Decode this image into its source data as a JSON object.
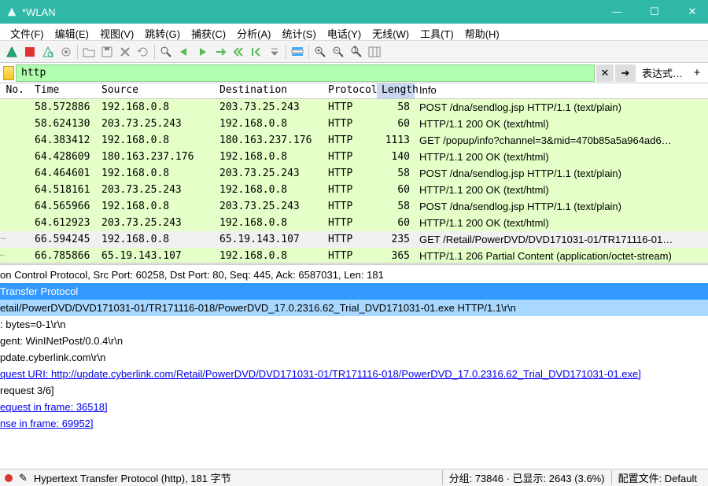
{
  "title": "*WLAN",
  "menu": [
    "文件(F)",
    "编辑(E)",
    "视图(V)",
    "跳转(G)",
    "捕获(C)",
    "分析(A)",
    "统计(S)",
    "电话(Y)",
    "无线(W)",
    "工具(T)",
    "帮助(H)"
  ],
  "filter": {
    "value": "http",
    "expr_label": "表达式…",
    "clear": "✕",
    "go": "➔",
    "plus": "+"
  },
  "columns": [
    "No.",
    "Time",
    "Source",
    "Destination",
    "Protocol",
    "Length",
    "Info"
  ],
  "rows": [
    {
      "no": "",
      "time": "58.572886",
      "src": "192.168.0.8",
      "dst": "203.73.25.243",
      "proto": "HTTP",
      "len": "58",
      "info": "POST /dna/sendlog.jsp HTTP/1.1  (text/plain)",
      "cls": "http"
    },
    {
      "no": "",
      "time": "58.624130",
      "src": "203.73.25.243",
      "dst": "192.168.0.8",
      "proto": "HTTP",
      "len": "60",
      "info": "HTTP/1.1 200 OK  (text/html)",
      "cls": "http"
    },
    {
      "no": "",
      "time": "64.383412",
      "src": "192.168.0.8",
      "dst": "180.163.237.176",
      "proto": "HTTP",
      "len": "1113",
      "info": "GET /popup/info?channel=3&mid=470b85a5a964ad6…",
      "cls": "http"
    },
    {
      "no": "",
      "time": "64.428609",
      "src": "180.163.237.176",
      "dst": "192.168.0.8",
      "proto": "HTTP",
      "len": "140",
      "info": "HTTP/1.1 200 OK  (text/html)",
      "cls": "http"
    },
    {
      "no": "",
      "time": "64.464601",
      "src": "192.168.0.8",
      "dst": "203.73.25.243",
      "proto": "HTTP",
      "len": "58",
      "info": "POST /dna/sendlog.jsp HTTP/1.1  (text/plain)",
      "cls": "http"
    },
    {
      "no": "",
      "time": "64.518161",
      "src": "203.73.25.243",
      "dst": "192.168.0.8",
      "proto": "HTTP",
      "len": "60",
      "info": "HTTP/1.1 200 OK  (text/html)",
      "cls": "http"
    },
    {
      "no": "",
      "time": "64.565966",
      "src": "192.168.0.8",
      "dst": "203.73.25.243",
      "proto": "HTTP",
      "len": "58",
      "info": "POST /dna/sendlog.jsp HTTP/1.1  (text/plain)",
      "cls": "http"
    },
    {
      "no": "",
      "time": "64.612923",
      "src": "203.73.25.243",
      "dst": "192.168.0.8",
      "proto": "HTTP",
      "len": "60",
      "info": "HTTP/1.1 200 OK  (text/html)",
      "cls": "http"
    },
    {
      "no": "",
      "time": "66.594245",
      "src": "192.168.0.8",
      "dst": "65.19.143.107",
      "proto": "HTTP",
      "len": "235",
      "info": "GET /Retail/PowerDVD/DVD171031-01/TR171116-01…",
      "cls": "sel"
    },
    {
      "no": "",
      "time": "66.785866",
      "src": "65.19.143.107",
      "dst": "192.168.0.8",
      "proto": "HTTP",
      "len": "365",
      "info": "HTTP/1.1 206 Partial Content  (application/octet-stream)",
      "cls": "http"
    }
  ],
  "details": [
    {
      "t": "on Control Protocol, Src Port: 60258, Dst Port: 80, Seq: 445, Ack: 6587031, Len: 181",
      "cls": ""
    },
    {
      "t": "Transfer Protocol",
      "cls": "sel"
    },
    {
      "t": "etail/PowerDVD/DVD171031-01/TR171116-018/PowerDVD_17.0.2316.62_Trial_DVD171031-01.exe HTTP/1.1\\r\\n",
      "cls": "sel2"
    },
    {
      "t": ": bytes=0-1\\r\\n",
      "cls": ""
    },
    {
      "t": "gent: WinINetPost/0.0.4\\r\\n",
      "cls": ""
    },
    {
      "t": "pdate.cyberlink.com\\r\\n",
      "cls": ""
    },
    {
      "t": "",
      "cls": ""
    },
    {
      "t": "quest URI: http://update.cyberlink.com/Retail/PowerDVD/DVD171031-01/TR171116-018/PowerDVD_17.0.2316.62_Trial_DVD171031-01.exe]",
      "cls": "link"
    },
    {
      "t": "request 3/6]",
      "cls": ""
    },
    {
      "t": "equest in frame: 36518]",
      "cls": "link"
    },
    {
      "t": "nse in frame: 69952]",
      "cls": "link"
    }
  ],
  "status": {
    "left": "Hypertext Transfer Protocol (http), 181 字节",
    "mid": "分组: 73846 · 已显示: 2643 (3.6%)",
    "right": "配置文件: Default"
  },
  "win": {
    "min": "—",
    "max": "☐",
    "close": "✕"
  }
}
